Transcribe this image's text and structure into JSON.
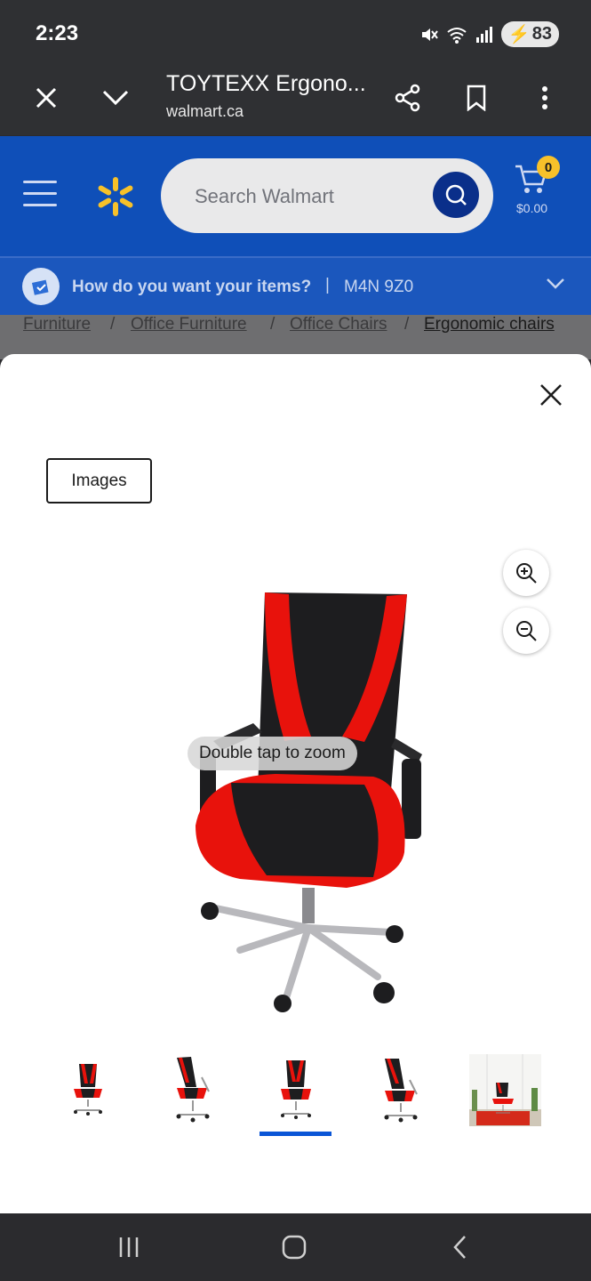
{
  "status_bar": {
    "time": "2:23",
    "battery": "83"
  },
  "browser": {
    "title": "TOYTEXX Ergono...",
    "url": "walmart.ca"
  },
  "header": {
    "search_placeholder": "Search Walmart",
    "cart_count": "0",
    "cart_total": "$0.00"
  },
  "delivery": {
    "question": "How do you want your items?",
    "separator": "|",
    "postal_code": "M4N 9Z0"
  },
  "breadcrumb": [
    {
      "label": "Furniture"
    },
    {
      "label": "Office Furniture"
    },
    {
      "label": "Office Chairs"
    },
    {
      "label": "Ergonomic chairs"
    }
  ],
  "breadcrumb_separator": "/",
  "viewer": {
    "tab_label": "Images",
    "zoom_hint": "Double tap to zoom",
    "thumbnail_count": 5,
    "selected_thumbnail": 3
  },
  "colors": {
    "walmart_blue": "#0f4fb8",
    "spark_yellow": "#f7c12a",
    "chair_red": "#e8120c",
    "indicator_blue": "#0a55d6"
  }
}
